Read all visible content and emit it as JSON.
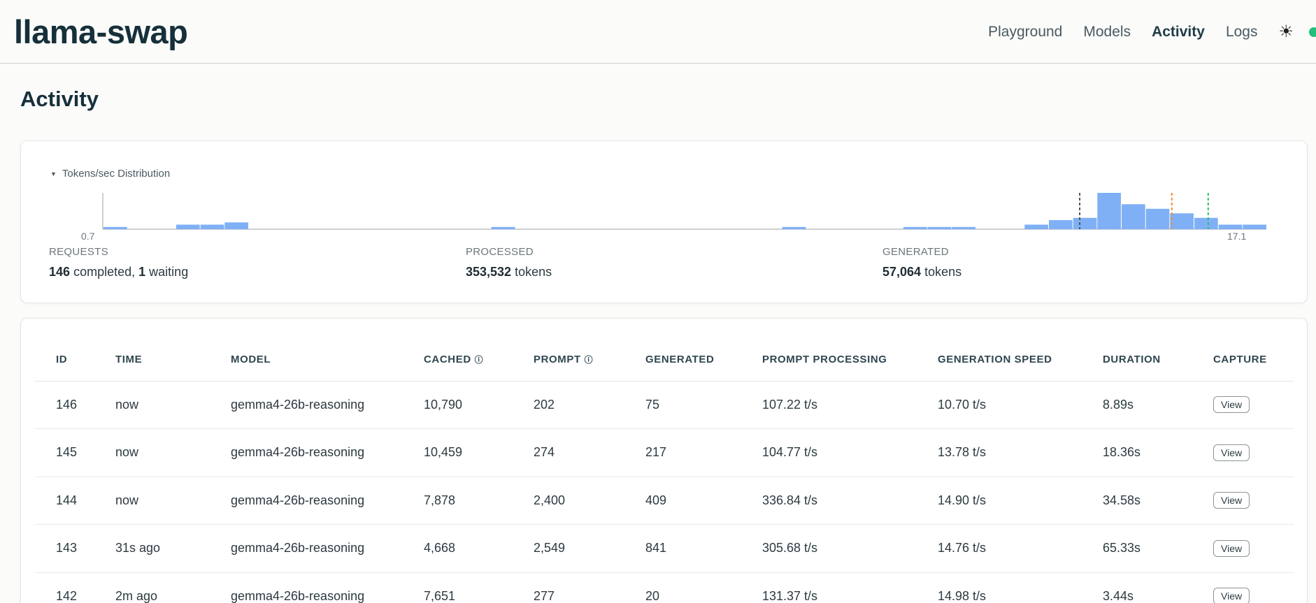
{
  "app": {
    "title": "llama-swap"
  },
  "nav": {
    "items": [
      {
        "label": "Playground",
        "active": false
      },
      {
        "label": "Models",
        "active": false
      },
      {
        "label": "Activity",
        "active": true
      },
      {
        "label": "Logs",
        "active": false
      }
    ],
    "theme_icon": "sun-icon",
    "status_color": "#22c07a"
  },
  "page": {
    "title": "Activity"
  },
  "distribution": {
    "toggle_label": "Tokens/sec Distribution",
    "min_label": "0.7",
    "max_label": "17.1",
    "bar_color": "#7fb0f5"
  },
  "chart_data": {
    "type": "bar",
    "x_min": 0.7,
    "x_max": 17.1,
    "bins": 46,
    "values": [
      1,
      0,
      0,
      2,
      2,
      3,
      0,
      0,
      0,
      0,
      0,
      0,
      0,
      0,
      0,
      0,
      1,
      0,
      0,
      0,
      0,
      0,
      0,
      0,
      0,
      0,
      0,
      0,
      1,
      0,
      0,
      0,
      0,
      1,
      1,
      1,
      0,
      0,
      2,
      4,
      5,
      16,
      11,
      9,
      7,
      5,
      2,
      2
    ],
    "markers": [
      {
        "color": "#555555",
        "style": "dashed"
      },
      {
        "color": "#f08a3c",
        "style": "dashed"
      },
      {
        "color": "#2bc06a",
        "style": "dashed"
      }
    ]
  },
  "stats": {
    "requests": {
      "label": "REQUESTS",
      "completed": "146",
      "completed_text": "completed,",
      "waiting": "1",
      "waiting_text": "waiting"
    },
    "processed": {
      "label": "PROCESSED",
      "value": "353,532",
      "unit": "tokens"
    },
    "generated": {
      "label": "GENERATED",
      "value": "57,064",
      "unit": "tokens"
    }
  },
  "table": {
    "columns": [
      "ID",
      "TIME",
      "MODEL",
      "CACHED",
      "PROMPT",
      "GENERATED",
      "PROMPT PROCESSING",
      "GENERATION SPEED",
      "DURATION",
      "CAPTURE"
    ],
    "view_label": "View",
    "rows": [
      {
        "id": "146",
        "time": "now",
        "model": "gemma4-26b-reasoning",
        "cached": "10,790",
        "prompt": "202",
        "generated": "75",
        "pp": "107.22 t/s",
        "gs": "10.70 t/s",
        "duration": "8.89s"
      },
      {
        "id": "145",
        "time": "now",
        "model": "gemma4-26b-reasoning",
        "cached": "10,459",
        "prompt": "274",
        "generated": "217",
        "pp": "104.77 t/s",
        "gs": "13.78 t/s",
        "duration": "18.36s"
      },
      {
        "id": "144",
        "time": "now",
        "model": "gemma4-26b-reasoning",
        "cached": "7,878",
        "prompt": "2,400",
        "generated": "409",
        "pp": "336.84 t/s",
        "gs": "14.90 t/s",
        "duration": "34.58s"
      },
      {
        "id": "143",
        "time": "31s ago",
        "model": "gemma4-26b-reasoning",
        "cached": "4,668",
        "prompt": "2,549",
        "generated": "841",
        "pp": "305.68 t/s",
        "gs": "14.76 t/s",
        "duration": "65.33s"
      },
      {
        "id": "142",
        "time": "2m ago",
        "model": "gemma4-26b-reasoning",
        "cached": "7,651",
        "prompt": "277",
        "generated": "20",
        "pp": "131.37 t/s",
        "gs": "14.98 t/s",
        "duration": "3.44s"
      }
    ]
  }
}
